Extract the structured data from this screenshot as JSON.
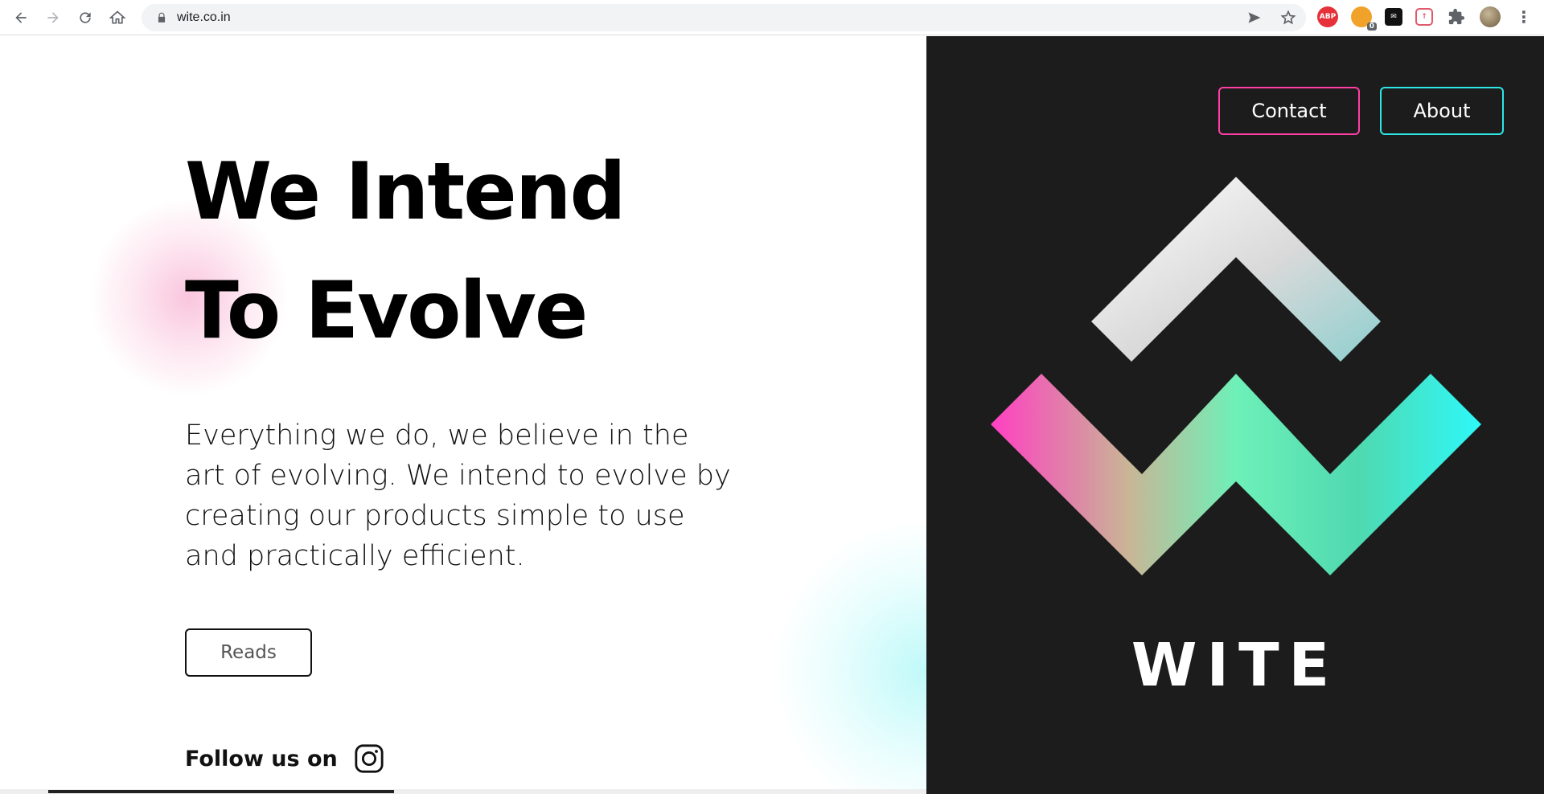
{
  "browser": {
    "url": "wite.co.in",
    "extension_badge": "0"
  },
  "hero": {
    "headline_line1": "We Intend",
    "headline_line2": "To Evolve",
    "description": "Everything we do, we believe in the art of evolving. We intend to evolve by creating our products simple to use and practically efficient.",
    "reads_label": "Reads",
    "follow_label": "Follow us on"
  },
  "nav": {
    "contact_label": "Contact",
    "about_label": "About"
  },
  "brand": {
    "wordmark": "WITE"
  },
  "colors": {
    "dark_panel": "#1c1c1c",
    "accent_pink": "#ff3fa5",
    "accent_cyan": "#2ee6e6"
  },
  "icons": [
    "back-icon",
    "forward-icon",
    "reload-icon",
    "home-icon",
    "lock-icon",
    "send-icon",
    "star-icon",
    "instagram-icon",
    "puzzle-icon",
    "menu-icon"
  ]
}
